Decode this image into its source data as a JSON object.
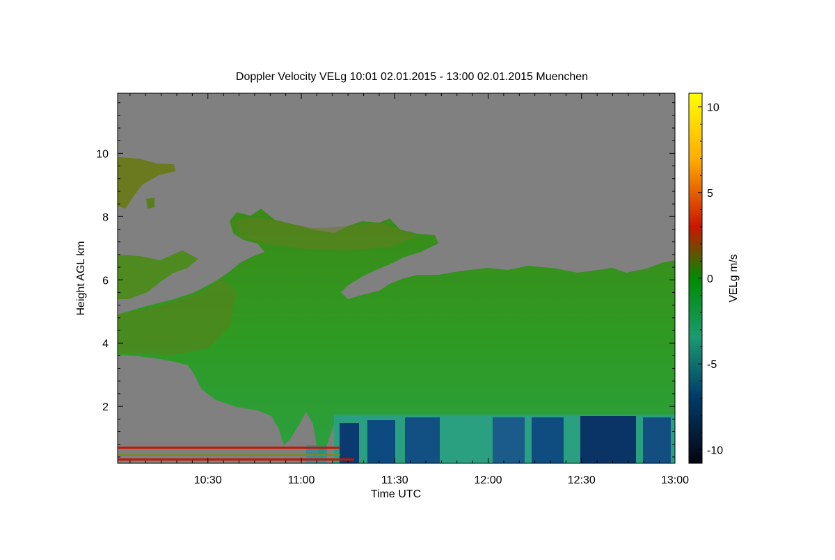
{
  "chart_data": {
    "type": "heatmap",
    "title": "Doppler Velocity VELg   10:01 02.01.2015 - 13:00 02.01.2015 Muenchen",
    "xlabel": "Time UTC",
    "ylabel": "Height AGL km",
    "colorbar_label": "VELg m/s",
    "xlim": [
      "10:01",
      "13:00"
    ],
    "ylim": [
      0.2,
      11.9
    ],
    "x_ticks": [
      "10:30",
      "11:00",
      "11:30",
      "12:00",
      "12:30",
      "13:00"
    ],
    "y_ticks": [
      2,
      4,
      6,
      8,
      10
    ],
    "colorbar_range": [
      -10.8,
      10.8
    ],
    "colorbar_ticks": [
      10,
      5,
      0,
      -5,
      -10
    ],
    "colorbar_colors": [
      "#ffff00",
      "#ff9900",
      "#cc1500",
      "#008c00",
      "#1a9a70",
      "#003c6a",
      "#050510"
    ],
    "no_data_color": "#808080",
    "regions": [
      {
        "desc": "cloud layer 4-6 km extending from start, rising to 8 km after 11:00",
        "values_approx_m_s": [
          -2,
          0
        ]
      },
      {
        "desc": "upper cloud 8-10 km at start",
        "values_approx_m_s": [
          0,
          1
        ]
      },
      {
        "desc": "boundary layer below 1.8 km after 11:15, strong downward velocities",
        "values_approx_m_s": [
          -10,
          -4
        ]
      }
    ]
  }
}
